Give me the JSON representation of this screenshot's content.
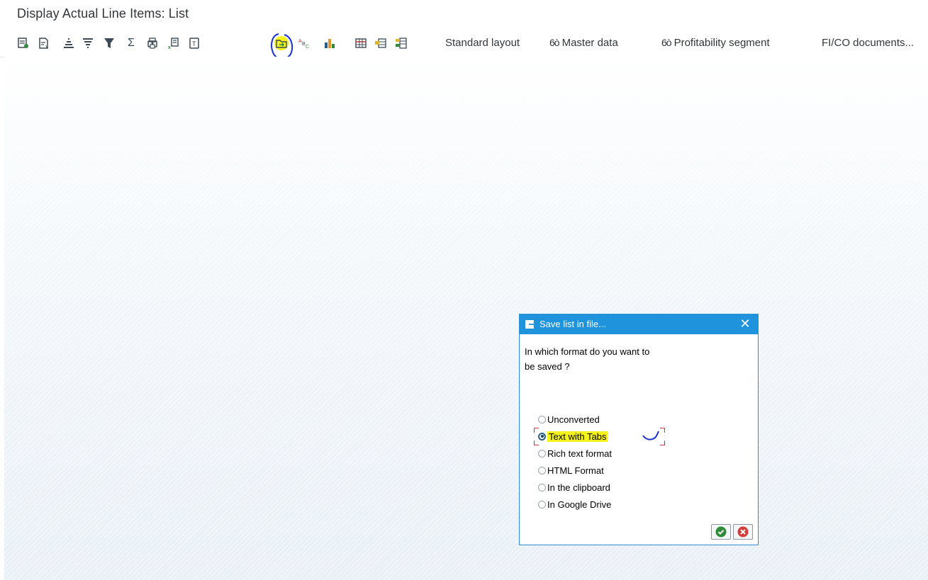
{
  "window": {
    "title": "Display Actual Line Items: List"
  },
  "toolbar": {
    "icons": [
      {
        "name": "details-icon"
      },
      {
        "name": "choose-layout-icon"
      },
      {
        "name": "sort-ascending-icon"
      },
      {
        "name": "sort-descending-icon"
      },
      {
        "name": "filter-icon"
      },
      {
        "name": "total-icon",
        "glyph": "Σ"
      },
      {
        "name": "print-preview-icon"
      },
      {
        "name": "export-spreadsheet-icon"
      },
      {
        "name": "word-processing-icon"
      },
      {
        "name": "local-file-icon"
      },
      {
        "name": "abc-analysis-icon"
      },
      {
        "name": "graphic-icon"
      },
      {
        "name": "change-layout-icon"
      },
      {
        "name": "save-layout-icon"
      },
      {
        "name": "manage-layouts-icon"
      }
    ],
    "standard_layout": "Standard layout",
    "master_data": "Master data",
    "profitability_segment": "Profitability segment",
    "fico_documents": "FI/CO documents..."
  },
  "dialog": {
    "title": "Save list in file...",
    "question_line1": "In which format do you want to",
    "question_line2": "be saved ?",
    "options": [
      {
        "label": "Unconverted",
        "checked": false
      },
      {
        "label": "Text with Tabs",
        "checked": true
      },
      {
        "label": "Rich text format",
        "checked": false
      },
      {
        "label": "HTML Format",
        "checked": false
      },
      {
        "label": "In the clipboard",
        "checked": false
      },
      {
        "label": "In Google Drive",
        "checked": false
      }
    ]
  },
  "colors": {
    "dialog_header": "#1f94dd",
    "highlight": "#f6f21c",
    "annotation_pen": "#1a33d8",
    "confirm_green": "#2e8b3a",
    "cancel_red": "#d63a3a"
  }
}
